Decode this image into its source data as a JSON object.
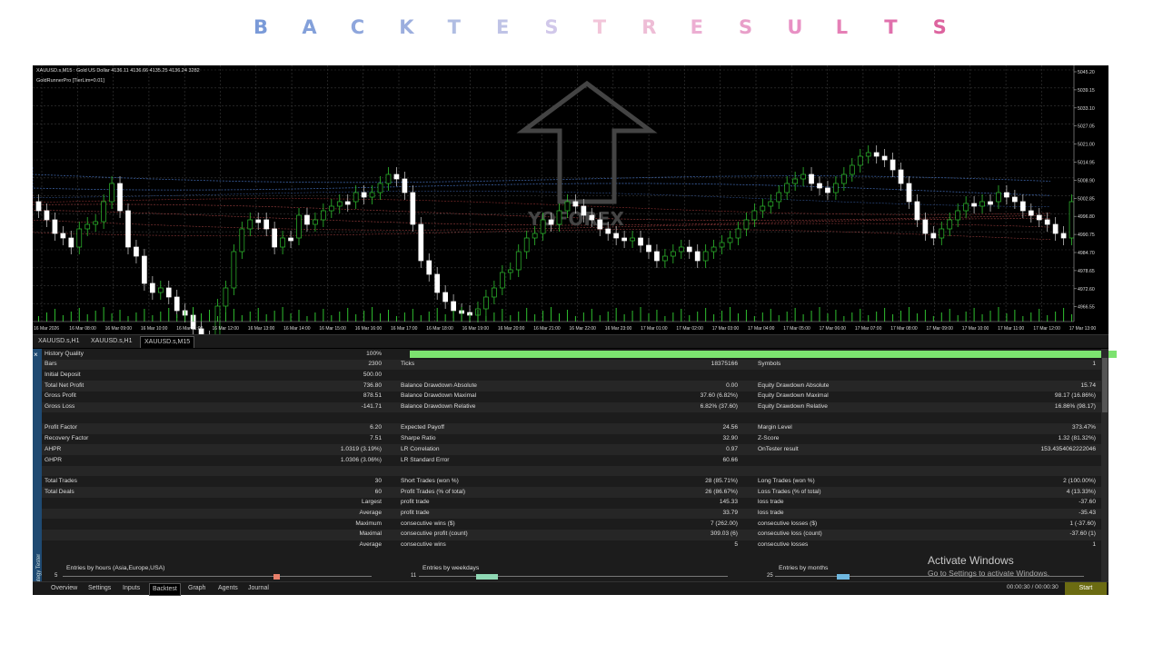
{
  "title": {
    "letters": [
      {
        "ch": "B",
        "color": "#7a9ad8"
      },
      {
        "ch": "A",
        "color": "#83a0da"
      },
      {
        "ch": "C",
        "color": "#8ea6dc"
      },
      {
        "ch": "K",
        "color": "#9caede"
      },
      {
        "ch": "T",
        "color": "#b0bde2"
      },
      {
        "ch": "E",
        "color": "#bfc3e6"
      },
      {
        "ch": "S",
        "color": "#d1c8ea"
      },
      {
        "ch": "T",
        "color": "#f2c5d9"
      },
      {
        "ch": "R",
        "color": "#eebdd6"
      },
      {
        "ch": "E",
        "color": "#ecaed2"
      },
      {
        "ch": "S",
        "color": "#e89fc9"
      },
      {
        "ch": "U",
        "color": "#e890c4"
      },
      {
        "ch": "L",
        "color": "#e57fb6"
      },
      {
        "ch": "T",
        "color": "#e070ac"
      },
      {
        "ch": "S",
        "color": "#dd649f"
      }
    ]
  },
  "chart": {
    "symbol_line": "XAUUSD.s,M15 : Gold US Dollar  4136.11 4136.66 4135.25 4136.24  3282",
    "ea_name": "GoldRunnerPro [TierLim=0.01]",
    "watermark": "YOFOREX",
    "price_labels": [
      "5045.20",
      "5039.15",
      "5033.10",
      "5027.05",
      "5021.00",
      "5014.95",
      "5008.90",
      "5002.85",
      "4996.80",
      "4990.75",
      "4984.70",
      "4978.65",
      "4972.60",
      "4966.55"
    ],
    "time_labels": [
      "16 Mar 2026",
      "16 Mar 08:00",
      "16 Mar 09:00",
      "16 Mar 10:00",
      "16 Mar 11:00",
      "16 Mar 12:00",
      "16 Mar 13:00",
      "16 Mar 14:00",
      "16 Mar 15:00",
      "16 Mar 16:00",
      "16 Mar 17:00",
      "16 Mar 18:00",
      "16 Mar 19:00",
      "16 Mar 20:00",
      "16 Mar 21:00",
      "16 Mar 22:00",
      "16 Mar 23:00",
      "17 Mar 01:00",
      "17 Mar 02:00",
      "17 Mar 03:00",
      "17 Mar 04:00",
      "17 Mar 05:00",
      "17 Mar 06:00",
      "17 Mar 07:00",
      "17 Mar 08:00",
      "17 Mar 09:00",
      "17 Mar 10:00",
      "17 Mar 11:00",
      "17 Mar 12:00",
      "17 Mar 13:00"
    ],
    "colors": {
      "bull": "#2fbf2f",
      "bear": "#ffffff",
      "grid": "#3a3a3a"
    }
  },
  "chart_tabs": [
    "XAUUSD.s,H1",
    "XAUUSD.s,H1",
    "XAUUSD.s,M15"
  ],
  "report": {
    "quality": {
      "label": "History Quality",
      "value": "100%"
    },
    "rows": [
      {
        "c1": "Bars",
        "v1": "2300",
        "c2": "Ticks",
        "v2": "18375166",
        "c3": "Symbols",
        "v3": "1"
      },
      {
        "c1": "Initial Deposit",
        "v1": "500.00",
        "c2": "",
        "v2": "",
        "c3": "",
        "v3": ""
      },
      {
        "c1": "Total Net Profit",
        "v1": "736.80",
        "c2": "Balance Drawdown Absolute",
        "v2": "0.00",
        "c3": "Equity Drawdown Absolute",
        "v3": "15.74"
      },
      {
        "c1": "Gross Profit",
        "v1": "878.51",
        "c2": "Balance Drawdown Maximal",
        "v2": "37.60 (6.82%)",
        "c3": "Equity Drawdown Maximal",
        "v3": "98.17 (16.86%)"
      },
      {
        "c1": "Gross Loss",
        "v1": "-141.71",
        "c2": "Balance Drawdown Relative",
        "v2": "6.82% (37.60)",
        "c3": "Equity Drawdown Relative",
        "v3": "16.86% (98.17)"
      },
      {
        "c1": "",
        "v1": "",
        "c2": "",
        "v2": "",
        "c3": "",
        "v3": ""
      },
      {
        "c1": "Profit Factor",
        "v1": "6.20",
        "c2": "Expected Payoff",
        "v2": "24.56",
        "c3": "Margin Level",
        "v3": "373.47%"
      },
      {
        "c1": "Recovery Factor",
        "v1": "7.51",
        "c2": "Sharpe Ratio",
        "v2": "32.90",
        "c3": "Z-Score",
        "v3": "1.32 (81.32%)"
      },
      {
        "c1": "AHPR",
        "v1": "1.0319 (3.19%)",
        "c2": "LR Correlation",
        "v2": "0.97",
        "c3": "OnTester result",
        "v3": "153.4354062222046"
      },
      {
        "c1": "GHPR",
        "v1": "1.0306 (3.06%)",
        "c2": "LR Standard Error",
        "v2": "60.66",
        "c3": "",
        "v3": ""
      },
      {
        "c1": "",
        "v1": "",
        "c2": "",
        "v2": "",
        "c3": "",
        "v3": ""
      },
      {
        "c1": "Total Trades",
        "v1": "30",
        "c2": "Short Trades (won %)",
        "v2": "28 (85.71%)",
        "c3": "Long Trades (won %)",
        "v3": "2 (100.00%)"
      },
      {
        "c1": "Total Deals",
        "v1": "60",
        "c2": "Profit Trades (% of total)",
        "v2": "26 (86.67%)",
        "c3": "Loss Trades (% of total)",
        "v3": "4 (13.33%)"
      },
      {
        "c1": "",
        "v1": "Largest",
        "c2": "profit trade",
        "v2": "145.33",
        "c3": "loss trade",
        "v3": "-37.60"
      },
      {
        "c1": "",
        "v1": "Average",
        "c2": "profit trade",
        "v2": "33.79",
        "c3": "loss trade",
        "v3": "-35.43"
      },
      {
        "c1": "",
        "v1": "Maximum",
        "c2": "consecutive wins ($)",
        "v2": "7 (262.00)",
        "c3": "consecutive losses ($)",
        "v3": "1 (-37.60)"
      },
      {
        "c1": "",
        "v1": "Maximal",
        "c2": "consecutive profit (count)",
        "v2": "309.03 (6)",
        "c3": "consecutive loss (count)",
        "v3": "-37.60 (1)"
      },
      {
        "c1": "",
        "v1": "Average",
        "c2": "consecutive wins",
        "v2": "5",
        "c3": "consecutive losses",
        "v3": "1"
      }
    ],
    "mini": [
      {
        "label": "Entries by hours (Asia,Europe,USA)",
        "num": "5",
        "marker": "#e8806b"
      },
      {
        "label": "Entries by weekdays",
        "num": "11",
        "marker": "#8fd8b4"
      },
      {
        "label": "Entries by months",
        "num": "25",
        "marker": "#6fb8e0"
      }
    ],
    "side_label": "Strategy Tester",
    "close_icon": "×"
  },
  "bottom_tabs": [
    "Overview",
    "Settings",
    "Inputs",
    "Backtest",
    "Graph",
    "Agents",
    "Journal"
  ],
  "active_bottom_tab": "Backtest",
  "timer": "00:00:30 / 00:00:30",
  "start_label": "Start",
  "activate": {
    "line1": "Activate Windows",
    "line2": "Go to Settings to activate Windows."
  }
}
